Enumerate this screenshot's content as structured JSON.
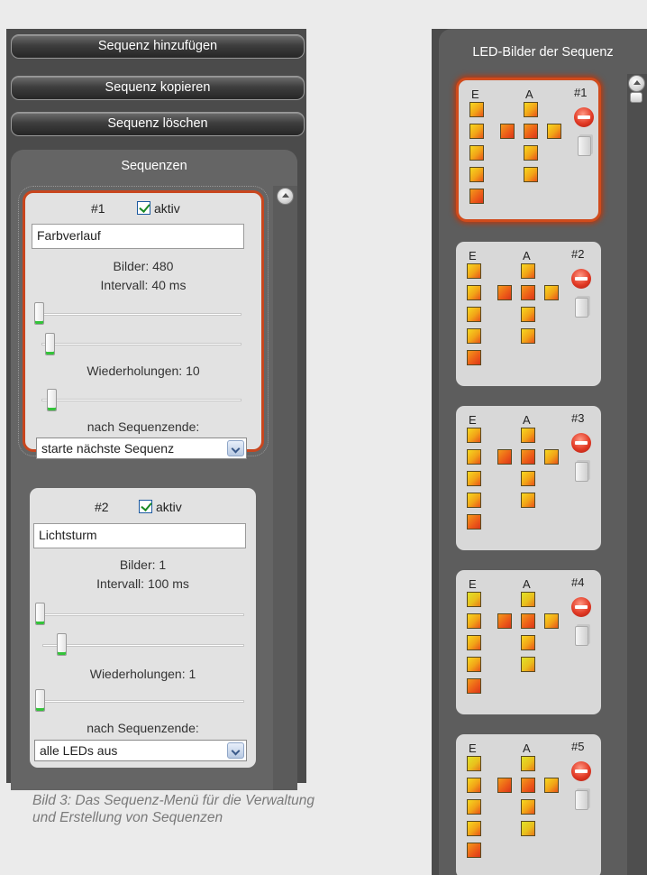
{
  "left_panel": {
    "buttons": [
      "Sequenz hinzufügen",
      "Sequenz kopieren",
      "Sequenz löschen"
    ],
    "title": "Sequenzen",
    "sequences": [
      {
        "number": "#1",
        "active_label": "aktiv",
        "active": true,
        "name": "Farbverlauf",
        "bilder": "Bilder: 480",
        "intervall": "Intervall: 40 ms",
        "wiederholungen": "Wiederholungen: 10",
        "end_label": "nach Sequenzende:",
        "end_action": "starte nächste Sequenz",
        "selected": true
      },
      {
        "number": "#2",
        "active_label": "aktiv",
        "active": true,
        "name": "Lichtsturm",
        "bilder": "Bilder: 1",
        "intervall": "Intervall: 100 ms",
        "wiederholungen": "Wiederholungen: 1",
        "end_label": "nach Sequenzende:",
        "end_action": "alle LEDs aus",
        "selected": false
      }
    ]
  },
  "caption": "Bild 3: Das Sequenz-Menü für die Verwaltung und Erstellung von Sequenzen",
  "right_panel": {
    "title": "LED-Bilder der Sequenz",
    "images": [
      {
        "number": "#1",
        "col_e": "E",
        "col_a": "A",
        "selected": true
      },
      {
        "number": "#2",
        "col_e": "E",
        "col_a": "A",
        "selected": false
      },
      {
        "number": "#3",
        "col_e": "E",
        "col_a": "A",
        "selected": false
      },
      {
        "number": "#4",
        "col_e": "E",
        "col_a": "A",
        "selected": false
      },
      {
        "number": "#5",
        "col_e": "E",
        "col_a": "A",
        "selected": false
      }
    ]
  },
  "colors": {
    "panel_bg": "#4b4b4b",
    "selection": "#c8461e",
    "led_yellow": "#f4d21e",
    "led_orange": "#f08a14",
    "led_red": "#e24a18",
    "checkbox_green": "#1a8a25"
  }
}
